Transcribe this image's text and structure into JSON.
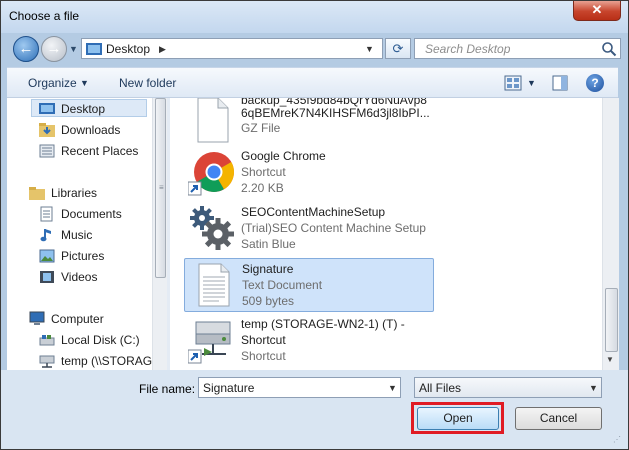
{
  "window": {
    "title": "Choose a file",
    "close_label": "✕"
  },
  "address": {
    "location": "Desktop",
    "search_placeholder": "Search Desktop"
  },
  "toolbar": {
    "organize_label": "Organize",
    "new_folder_label": "New folder"
  },
  "nav": {
    "items": [
      {
        "label": "Desktop",
        "icon": "desktop-icon",
        "selected": true
      },
      {
        "label": "Downloads",
        "icon": "downloads-folder-icon"
      },
      {
        "label": "Recent Places",
        "icon": "recent-places-icon"
      },
      {
        "label": "Libraries",
        "icon": "libraries-icon"
      },
      {
        "label": "Documents",
        "icon": "documents-icon"
      },
      {
        "label": "Music",
        "icon": "music-icon"
      },
      {
        "label": "Pictures",
        "icon": "pictures-icon"
      },
      {
        "label": "Videos",
        "icon": "videos-icon"
      },
      {
        "label": "Computer",
        "icon": "computer-icon"
      },
      {
        "label": "Local Disk (C:)",
        "icon": "local-disk-icon"
      },
      {
        "label": "temp (\\\\STORAG",
        "icon": "network-drive-icon"
      }
    ]
  },
  "files": [
    {
      "name": "backup_435f9bd84bQrYd6NuAvp8",
      "name2": "6qBEMreK7N4KIHSFM6d3jl8IbPI...",
      "type": "GZ File",
      "icon": "file-icon"
    },
    {
      "name": "Google Chrome",
      "type": "Shortcut",
      "size": "2.20 KB",
      "icon": "chrome-icon"
    },
    {
      "name": "SEOContentMachineSetup",
      "type": "(Trial)SEO Content Machine Setup",
      "size": "Satin Blue",
      "icon": "gear-icon"
    },
    {
      "name": "Signature",
      "type": "Text Document",
      "size": "509 bytes",
      "icon": "text-document-icon",
      "selected": true
    },
    {
      "name": "temp (STORAGE-WN2-1) (T) -",
      "name2": "Shortcut",
      "type": "Shortcut",
      "icon": "network-drive-shortcut-icon"
    }
  ],
  "bottom": {
    "file_name_label": "File name:",
    "file_name_value": "Signature",
    "file_type_value": "All Files",
    "open_label": "Open",
    "cancel_label": "Cancel"
  },
  "colors": {
    "highlight": "#e01b24",
    "selection": "#cfe3fa",
    "chrome": "#b4cbe3"
  }
}
